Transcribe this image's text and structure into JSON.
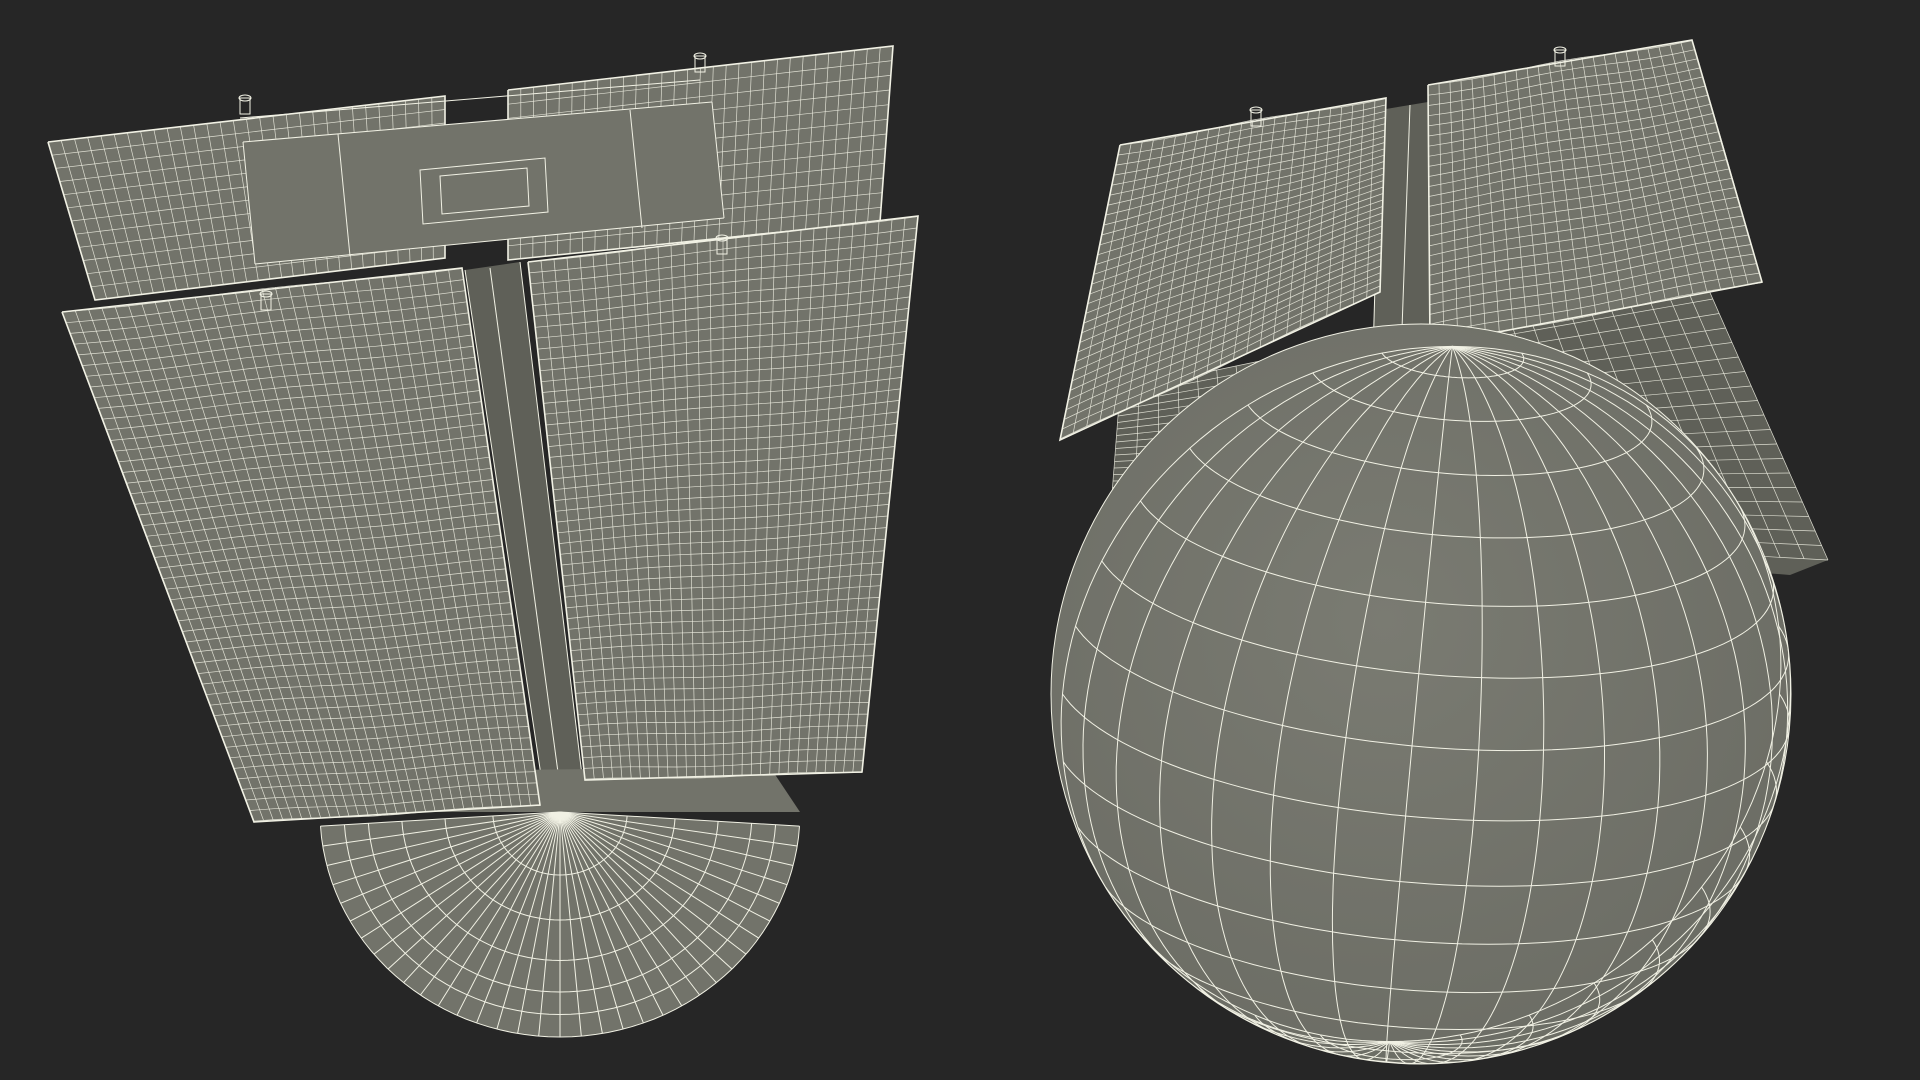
{
  "scene": {
    "background_color": "#262626",
    "surface_color": "#72736a",
    "surface_shadow_color": "#5f6058",
    "wire_color": "#f1f1e4",
    "views": [
      {
        "name": "left-view",
        "components": [
          "panel-back-left",
          "panel-back-right",
          "body-box",
          "boom",
          "panel-front-left",
          "panel-front-right",
          "dish-disc"
        ]
      },
      {
        "name": "right-view",
        "components": [
          "panel-back-shadow",
          "body-box",
          "panel-top-left",
          "panel-top-right",
          "sphere"
        ]
      }
    ]
  }
}
